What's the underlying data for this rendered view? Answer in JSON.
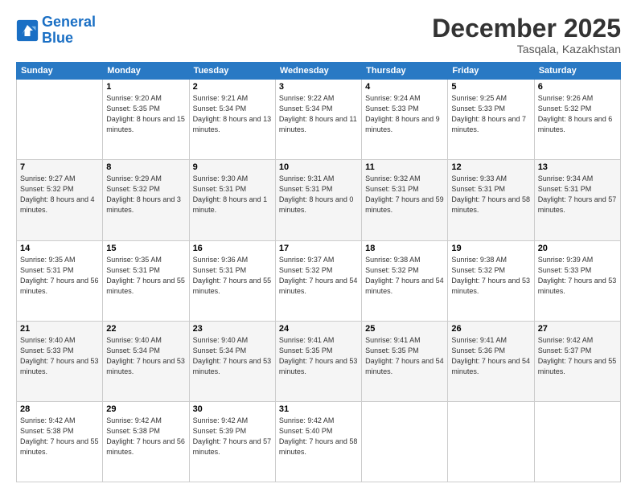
{
  "header": {
    "logo_line1": "General",
    "logo_line2": "Blue",
    "month_year": "December 2025",
    "location": "Tasqala, Kazakhstan"
  },
  "weekdays": [
    "Sunday",
    "Monday",
    "Tuesday",
    "Wednesday",
    "Thursday",
    "Friday",
    "Saturday"
  ],
  "weeks": [
    [
      {
        "day": "",
        "sunrise": "",
        "sunset": "",
        "daylight": ""
      },
      {
        "day": "1",
        "sunrise": "Sunrise: 9:20 AM",
        "sunset": "Sunset: 5:35 PM",
        "daylight": "Daylight: 8 hours and 15 minutes."
      },
      {
        "day": "2",
        "sunrise": "Sunrise: 9:21 AM",
        "sunset": "Sunset: 5:34 PM",
        "daylight": "Daylight: 8 hours and 13 minutes."
      },
      {
        "day": "3",
        "sunrise": "Sunrise: 9:22 AM",
        "sunset": "Sunset: 5:34 PM",
        "daylight": "Daylight: 8 hours and 11 minutes."
      },
      {
        "day": "4",
        "sunrise": "Sunrise: 9:24 AM",
        "sunset": "Sunset: 5:33 PM",
        "daylight": "Daylight: 8 hours and 9 minutes."
      },
      {
        "day": "5",
        "sunrise": "Sunrise: 9:25 AM",
        "sunset": "Sunset: 5:33 PM",
        "daylight": "Daylight: 8 hours and 7 minutes."
      },
      {
        "day": "6",
        "sunrise": "Sunrise: 9:26 AM",
        "sunset": "Sunset: 5:32 PM",
        "daylight": "Daylight: 8 hours and 6 minutes."
      }
    ],
    [
      {
        "day": "7",
        "sunrise": "Sunrise: 9:27 AM",
        "sunset": "Sunset: 5:32 PM",
        "daylight": "Daylight: 8 hours and 4 minutes."
      },
      {
        "day": "8",
        "sunrise": "Sunrise: 9:29 AM",
        "sunset": "Sunset: 5:32 PM",
        "daylight": "Daylight: 8 hours and 3 minutes."
      },
      {
        "day": "9",
        "sunrise": "Sunrise: 9:30 AM",
        "sunset": "Sunset: 5:31 PM",
        "daylight": "Daylight: 8 hours and 1 minute."
      },
      {
        "day": "10",
        "sunrise": "Sunrise: 9:31 AM",
        "sunset": "Sunset: 5:31 PM",
        "daylight": "Daylight: 8 hours and 0 minutes."
      },
      {
        "day": "11",
        "sunrise": "Sunrise: 9:32 AM",
        "sunset": "Sunset: 5:31 PM",
        "daylight": "Daylight: 7 hours and 59 minutes."
      },
      {
        "day": "12",
        "sunrise": "Sunrise: 9:33 AM",
        "sunset": "Sunset: 5:31 PM",
        "daylight": "Daylight: 7 hours and 58 minutes."
      },
      {
        "day": "13",
        "sunrise": "Sunrise: 9:34 AM",
        "sunset": "Sunset: 5:31 PM",
        "daylight": "Daylight: 7 hours and 57 minutes."
      }
    ],
    [
      {
        "day": "14",
        "sunrise": "Sunrise: 9:35 AM",
        "sunset": "Sunset: 5:31 PM",
        "daylight": "Daylight: 7 hours and 56 minutes."
      },
      {
        "day": "15",
        "sunrise": "Sunrise: 9:35 AM",
        "sunset": "Sunset: 5:31 PM",
        "daylight": "Daylight: 7 hours and 55 minutes."
      },
      {
        "day": "16",
        "sunrise": "Sunrise: 9:36 AM",
        "sunset": "Sunset: 5:31 PM",
        "daylight": "Daylight: 7 hours and 55 minutes."
      },
      {
        "day": "17",
        "sunrise": "Sunrise: 9:37 AM",
        "sunset": "Sunset: 5:32 PM",
        "daylight": "Daylight: 7 hours and 54 minutes."
      },
      {
        "day": "18",
        "sunrise": "Sunrise: 9:38 AM",
        "sunset": "Sunset: 5:32 PM",
        "daylight": "Daylight: 7 hours and 54 minutes."
      },
      {
        "day": "19",
        "sunrise": "Sunrise: 9:38 AM",
        "sunset": "Sunset: 5:32 PM",
        "daylight": "Daylight: 7 hours and 53 minutes."
      },
      {
        "day": "20",
        "sunrise": "Sunrise: 9:39 AM",
        "sunset": "Sunset: 5:33 PM",
        "daylight": "Daylight: 7 hours and 53 minutes."
      }
    ],
    [
      {
        "day": "21",
        "sunrise": "Sunrise: 9:40 AM",
        "sunset": "Sunset: 5:33 PM",
        "daylight": "Daylight: 7 hours and 53 minutes."
      },
      {
        "day": "22",
        "sunrise": "Sunrise: 9:40 AM",
        "sunset": "Sunset: 5:34 PM",
        "daylight": "Daylight: 7 hours and 53 minutes."
      },
      {
        "day": "23",
        "sunrise": "Sunrise: 9:40 AM",
        "sunset": "Sunset: 5:34 PM",
        "daylight": "Daylight: 7 hours and 53 minutes."
      },
      {
        "day": "24",
        "sunrise": "Sunrise: 9:41 AM",
        "sunset": "Sunset: 5:35 PM",
        "daylight": "Daylight: 7 hours and 53 minutes."
      },
      {
        "day": "25",
        "sunrise": "Sunrise: 9:41 AM",
        "sunset": "Sunset: 5:35 PM",
        "daylight": "Daylight: 7 hours and 54 minutes."
      },
      {
        "day": "26",
        "sunrise": "Sunrise: 9:41 AM",
        "sunset": "Sunset: 5:36 PM",
        "daylight": "Daylight: 7 hours and 54 minutes."
      },
      {
        "day": "27",
        "sunrise": "Sunrise: 9:42 AM",
        "sunset": "Sunset: 5:37 PM",
        "daylight": "Daylight: 7 hours and 55 minutes."
      }
    ],
    [
      {
        "day": "28",
        "sunrise": "Sunrise: 9:42 AM",
        "sunset": "Sunset: 5:38 PM",
        "daylight": "Daylight: 7 hours and 55 minutes."
      },
      {
        "day": "29",
        "sunrise": "Sunrise: 9:42 AM",
        "sunset": "Sunset: 5:38 PM",
        "daylight": "Daylight: 7 hours and 56 minutes."
      },
      {
        "day": "30",
        "sunrise": "Sunrise: 9:42 AM",
        "sunset": "Sunset: 5:39 PM",
        "daylight": "Daylight: 7 hours and 57 minutes."
      },
      {
        "day": "31",
        "sunrise": "Sunrise: 9:42 AM",
        "sunset": "Sunset: 5:40 PM",
        "daylight": "Daylight: 7 hours and 58 minutes."
      },
      {
        "day": "",
        "sunrise": "",
        "sunset": "",
        "daylight": ""
      },
      {
        "day": "",
        "sunrise": "",
        "sunset": "",
        "daylight": ""
      },
      {
        "day": "",
        "sunrise": "",
        "sunset": "",
        "daylight": ""
      }
    ]
  ]
}
